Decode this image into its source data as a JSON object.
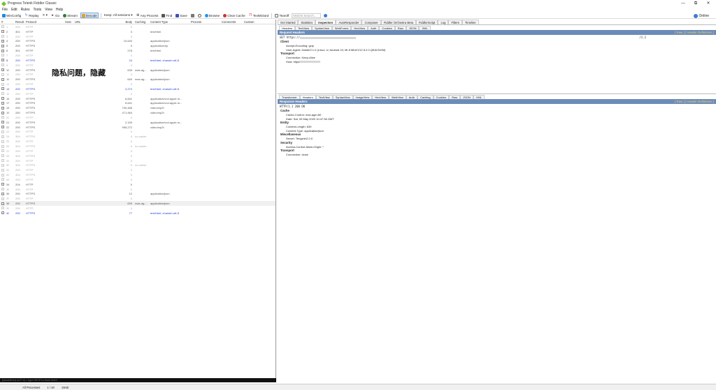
{
  "window": {
    "title": "Progress Telerik Fiddler Classic",
    "controls": [
      "—",
      "⧉",
      "✕"
    ]
  },
  "menu": [
    "File",
    "Edit",
    "Rules",
    "Tools",
    "View",
    "Help"
  ],
  "toolbar": {
    "winconfig": "WinConfig",
    "replay": "Replay",
    "remove": "✕ ▾",
    "go": "Go",
    "stream": "Stream",
    "decode": "Decode",
    "keep": "Keep: All sessions ▾",
    "any_process": "Any Process",
    "find": "Find",
    "save": "Save",
    "browse": "Browse",
    "clear_cache": "Clear Cache",
    "textwizard": "TextWizard",
    "tearoff": "Tearoff",
    "search_placeholder": "MSDN Search...",
    "online": "Online"
  },
  "sessions": {
    "columns": [
      "#",
      "Result",
      "Protocol",
      "Host",
      "URL",
      "Body",
      "Caching",
      "Content-Type",
      "Process",
      "Comments",
      "Custom"
    ],
    "rows": [
      {
        "id": "1",
        "result": "200",
        "protocol": "HTTP",
        "body": "0",
        "caching": "",
        "ctype": "",
        "style": "grey"
      },
      {
        "id": "2",
        "result": "301",
        "protocol": "HTTP",
        "body": "0",
        "caching": "",
        "ctype": "text/html",
        "style": "normal"
      },
      {
        "id": "3",
        "result": "200",
        "protocol": "HTTP",
        "body": "0",
        "caching": "",
        "ctype": "",
        "style": "grey"
      },
      {
        "id": "4",
        "result": "200",
        "protocol": "HTTPS",
        "body": "10,640",
        "caching": "",
        "ctype": "application/json",
        "style": "normal"
      },
      {
        "id": "5",
        "result": "200",
        "protocol": "HTTPS",
        "body": "0",
        "caching": "",
        "ctype": "application/zip",
        "style": "normal"
      },
      {
        "id": "6",
        "result": "301",
        "protocol": "HTTP",
        "body": "278",
        "caching": "",
        "ctype": "text/html",
        "style": "normal"
      },
      {
        "id": "7",
        "result": "200",
        "protocol": "HTTP",
        "body": "0",
        "caching": "",
        "ctype": "",
        "style": "grey"
      },
      {
        "id": "8",
        "result": "200",
        "protocol": "HTTPS",
        "body": "24",
        "caching": "",
        "ctype": "text/html; charset=utf-8",
        "style": "blue"
      },
      {
        "id": "9",
        "result": "200",
        "protocol": "HTTP",
        "body": "0",
        "caching": "",
        "ctype": "",
        "style": "grey"
      },
      {
        "id": "10",
        "result": "200",
        "protocol": "HTTPS",
        "body": "639",
        "caching": "max-ag...",
        "ctype": "application/json",
        "style": "normal"
      },
      {
        "id": "11",
        "result": "200",
        "protocol": "HTTP",
        "body": "0",
        "caching": "",
        "ctype": "",
        "style": "grey"
      },
      {
        "id": "12",
        "result": "200",
        "protocol": "HTTPS",
        "body": "640",
        "caching": "max-ag...",
        "ctype": "application/json",
        "style": "normal"
      },
      {
        "id": "13",
        "result": "200",
        "protocol": "HTTP",
        "body": "0",
        "caching": "",
        "ctype": "",
        "style": "grey"
      },
      {
        "id": "14",
        "result": "200",
        "protocol": "HTTPS",
        "body": "2,272",
        "caching": "",
        "ctype": "text/html; charset=utf-8",
        "style": "blue"
      },
      {
        "id": "15",
        "result": "200",
        "protocol": "HTTP",
        "body": "0",
        "caching": "",
        "ctype": "",
        "style": "grey"
      },
      {
        "id": "16",
        "result": "200",
        "protocol": "HTTPS",
        "body": "6,841",
        "caching": "",
        "ctype": "application/vnd.apple.m...",
        "style": "normal"
      },
      {
        "id": "17",
        "result": "200",
        "protocol": "HTTPS",
        "body": "6,641",
        "caching": "",
        "ctype": "application/vnd.apple.m...",
        "style": "normal"
      },
      {
        "id": "18",
        "result": "200",
        "protocol": "HTTPS",
        "body": "700,486",
        "caching": "",
        "ctype": "video/mp2t",
        "style": "normal"
      },
      {
        "id": "19",
        "result": "200",
        "protocol": "HTTPS",
        "body": "471,964",
        "caching": "",
        "ctype": "video/mp2t",
        "style": "normal"
      },
      {
        "id": "20",
        "result": "200",
        "protocol": "HTTP",
        "body": "0",
        "caching": "",
        "ctype": "",
        "style": "grey"
      },
      {
        "id": "21",
        "result": "200",
        "protocol": "HTTPS",
        "body": "2,159",
        "caching": "",
        "ctype": "application/vnd.apple.m...",
        "style": "normal"
      },
      {
        "id": "22",
        "result": "200",
        "protocol": "HTTPS",
        "body": "995,272",
        "caching": "",
        "ctype": "video/mp2t",
        "style": "normal"
      },
      {
        "id": "23",
        "result": "200",
        "protocol": "HTTP",
        "body": "0",
        "caching": "",
        "ctype": "",
        "style": "grey"
      },
      {
        "id": "24",
        "result": "304",
        "protocol": "HTTPS",
        "body": "0",
        "caching": "no-cache",
        "ctype": "",
        "style": "grey"
      },
      {
        "id": "25",
        "result": "200",
        "protocol": "HTTP",
        "body": "0",
        "caching": "",
        "ctype": "",
        "style": "grey"
      },
      {
        "id": "26",
        "result": "304",
        "protocol": "HTTPS",
        "body": "0",
        "caching": "no-cache",
        "ctype": "",
        "style": "grey"
      },
      {
        "id": "27",
        "result": "200",
        "protocol": "HTTP",
        "body": "0",
        "caching": "",
        "ctype": "",
        "style": "grey"
      },
      {
        "id": "28",
        "result": "304",
        "protocol": "HTTPS",
        "body": "0",
        "caching": "",
        "ctype": "",
        "style": "grey"
      },
      {
        "id": "29",
        "result": "200",
        "protocol": "HTTP",
        "body": "0",
        "caching": "",
        "ctype": "",
        "style": "grey"
      },
      {
        "id": "30",
        "result": "304",
        "protocol": "HTTPS",
        "body": "0",
        "caching": "no-cache",
        "ctype": "",
        "style": "grey"
      },
      {
        "id": "31",
        "result": "200",
        "protocol": "HTTP",
        "body": "0",
        "caching": "",
        "ctype": "",
        "style": "grey"
      },
      {
        "id": "32",
        "result": "304",
        "protocol": "HTTPS",
        "body": "0",
        "caching": "",
        "ctype": "",
        "style": "grey"
      },
      {
        "id": "33",
        "result": "200",
        "protocol": "HTTP",
        "body": "0",
        "caching": "",
        "ctype": "",
        "style": "grey"
      },
      {
        "id": "34",
        "result": "204",
        "protocol": "HTTP",
        "body": "0",
        "caching": "",
        "ctype": "",
        "style": "normal"
      },
      {
        "id": "35",
        "result": "200",
        "protocol": "HTTP",
        "body": "0",
        "caching": "",
        "ctype": "",
        "style": "grey"
      },
      {
        "id": "36",
        "result": "200",
        "protocol": "HTTPS",
        "body": "12",
        "caching": "",
        "ctype": "application/json",
        "style": "normal"
      },
      {
        "id": "37",
        "result": "200",
        "protocol": "HTTP",
        "body": "0",
        "caching": "",
        "ctype": "",
        "style": "grey"
      },
      {
        "id": "38",
        "result": "200",
        "protocol": "HTTPS",
        "body": "639",
        "caching": "max-ag...",
        "ctype": "application/json",
        "style": "sel"
      },
      {
        "id": "39",
        "result": "200",
        "protocol": "HTTP",
        "body": "0",
        "caching": "",
        "ctype": "",
        "style": "grey"
      },
      {
        "id": "40",
        "result": "200",
        "protocol": "HTTPS",
        "body": "77",
        "caching": "",
        "ctype": "text/html; charset=utf-8",
        "style": "blue"
      }
    ]
  },
  "privacy_overlay": "隐私问题，隐藏",
  "inspector_tabs": [
    "Get Started",
    "Statistics",
    "Inspectors",
    "AutoResponder",
    "Composer",
    "Fiddler Orchestra Beta",
    "FiddlerScript",
    "Log",
    "Filters",
    "Timeline"
  ],
  "request": {
    "tabs": [
      "Headers",
      "TextView",
      "SyntaxView",
      "WebForms",
      "HexView",
      "Auth",
      "Cookies",
      "Raw",
      "JSON",
      "XML"
    ],
    "bar_title": "Request Headers",
    "links": "[ Raw ]   [ Header Definitions ]",
    "request_line_start": "GET https://",
    "request_line_end": "/1.1",
    "sections": [
      {
        "name": "Client",
        "items": [
          "Accept-Encoding: gzip",
          "User-Agent: Dalvik/2.1.0 (Linux; U; Android 10; MI 8 MIUI/V12.5.2.0.QEACNXM)"
        ]
      },
      {
        "name": "Transport",
        "items": [
          "Connection: Keep-Alive",
          "Host: https"
        ]
      }
    ]
  },
  "response": {
    "tabs": [
      "Transformer",
      "Headers",
      "TextView",
      "SyntaxView",
      "ImageView",
      "HexView",
      "WebView",
      "Auth",
      "Caching",
      "Cookies",
      "Raw",
      "JSON",
      "XML"
    ],
    "bar_title": "Response Headers",
    "links": "[ Raw ]   [ Header Definitions ]",
    "status_line": "HTTP/1.1 200 OK",
    "sections": [
      {
        "name": "Cache",
        "items": [
          "Cache-Control: max-age=60",
          "Date: Sat, 09 May 2020 10:47:38 GMT"
        ]
      },
      {
        "name": "Entity",
        "items": [
          "Content-Length: 639",
          "Content-Type: application/json"
        ]
      },
      {
        "name": "Miscellaneous",
        "items": [
          "Server: Tengine/2.0.0"
        ]
      },
      {
        "name": "Security",
        "items": [
          "Access-Control-Allow-Origin: *"
        ]
      },
      {
        "name": "Transport",
        "items": [
          "Connection: close"
        ]
      }
    ]
  },
  "quickexec": "[QuickExec] ALT+Q > type HELP to learn more",
  "status": {
    "processes": "All Processes",
    "count": "1 / 40",
    "size": "19mb"
  }
}
